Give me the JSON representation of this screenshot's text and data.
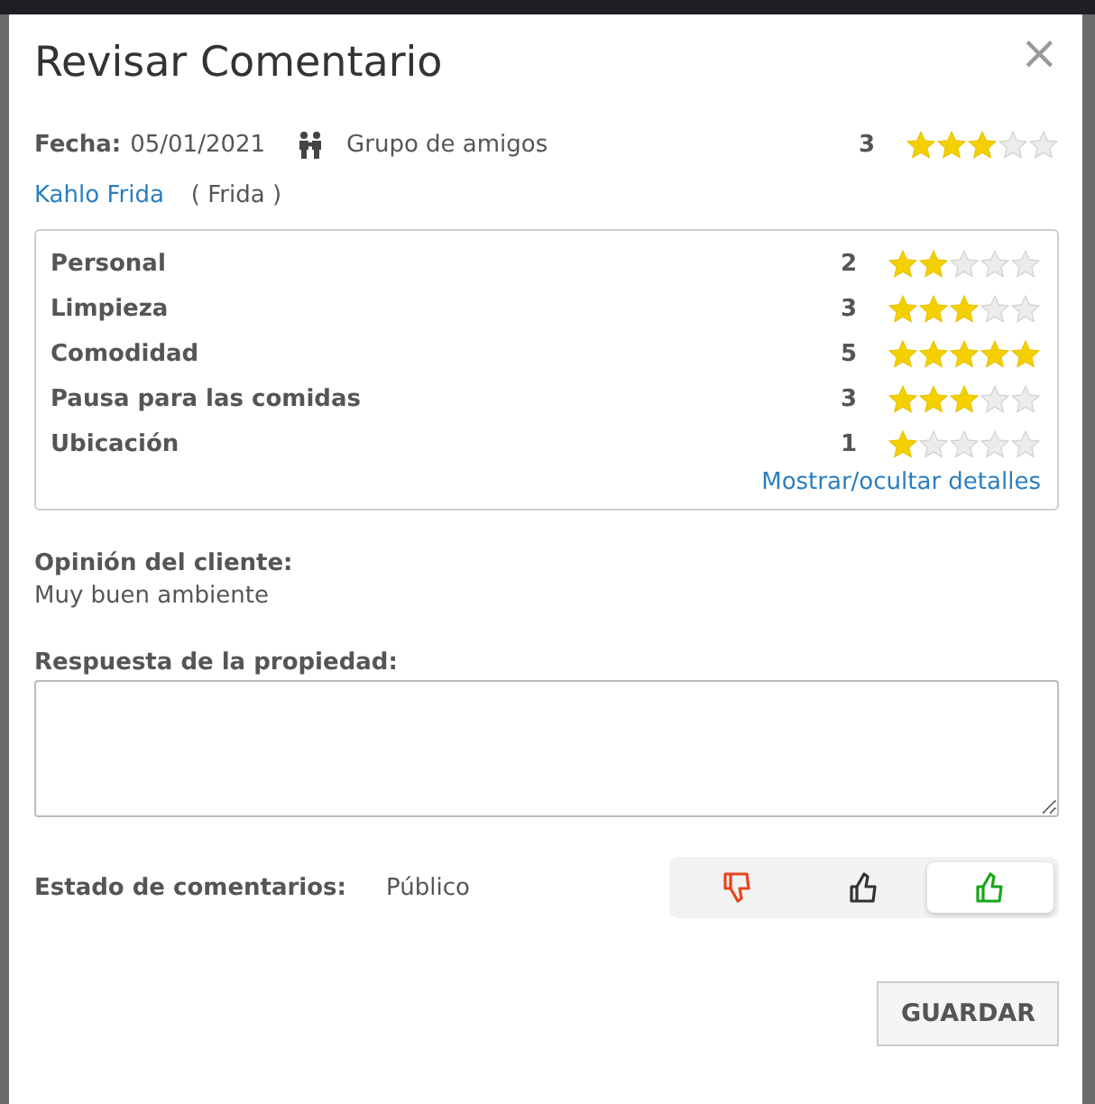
{
  "dialog": {
    "title": "Revisar Comentario",
    "close": "×"
  },
  "meta": {
    "date_label": "Fecha:",
    "date": "05/01/2021",
    "group": "Grupo de amigos",
    "score": "3",
    "stars": 3
  },
  "guest": {
    "name": "Kahlo Frida",
    "nickname": "( Frida )"
  },
  "ratings": [
    {
      "label": "Personal",
      "score": "2",
      "stars": 2
    },
    {
      "label": "Limpieza",
      "score": "3",
      "stars": 3
    },
    {
      "label": "Comodidad",
      "score": "5",
      "stars": 5
    },
    {
      "label": "Pausa para las comidas",
      "score": "3",
      "stars": 3
    },
    {
      "label": "Ubicación",
      "score": "1",
      "stars": 1
    }
  ],
  "details_link": "Mostrar/ocultar detalles",
  "opinion": {
    "label": "Opinión del cliente:",
    "text": "Muy buen ambiente"
  },
  "response": {
    "label": "Respuesta de la propiedad:"
  },
  "status": {
    "label": "Estado de comentarios:",
    "value": "Público",
    "options": [
      {
        "kind": "down",
        "selected": false
      },
      {
        "kind": "neutral",
        "selected": false
      },
      {
        "kind": "up",
        "selected": true
      }
    ]
  },
  "save_button": "GUARDAR"
}
